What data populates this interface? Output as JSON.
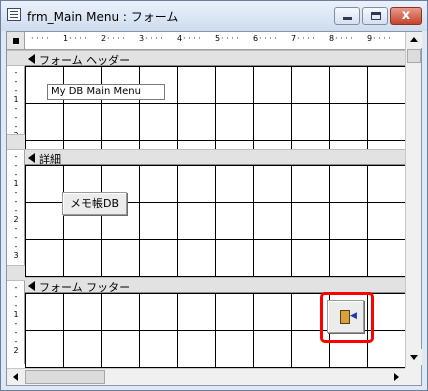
{
  "window": {
    "title": "frm_Main Menu : フォーム",
    "close_label": "x"
  },
  "ruler": {
    "marks": [
      "1",
      "2",
      "3",
      "4",
      "5",
      "6",
      "7",
      "8",
      "9"
    ]
  },
  "sections": {
    "header": {
      "label": "フォーム ヘッダー"
    },
    "detail": {
      "label": "詳細"
    },
    "footer": {
      "label": "フォーム フッター"
    }
  },
  "controls": {
    "title_label": "My DB Main Menu",
    "memo_button": "メモ帳DB",
    "exit_button_icon": "exit-door-icon"
  },
  "colors": {
    "highlight": "#ff0000",
    "grid": "#000000"
  }
}
